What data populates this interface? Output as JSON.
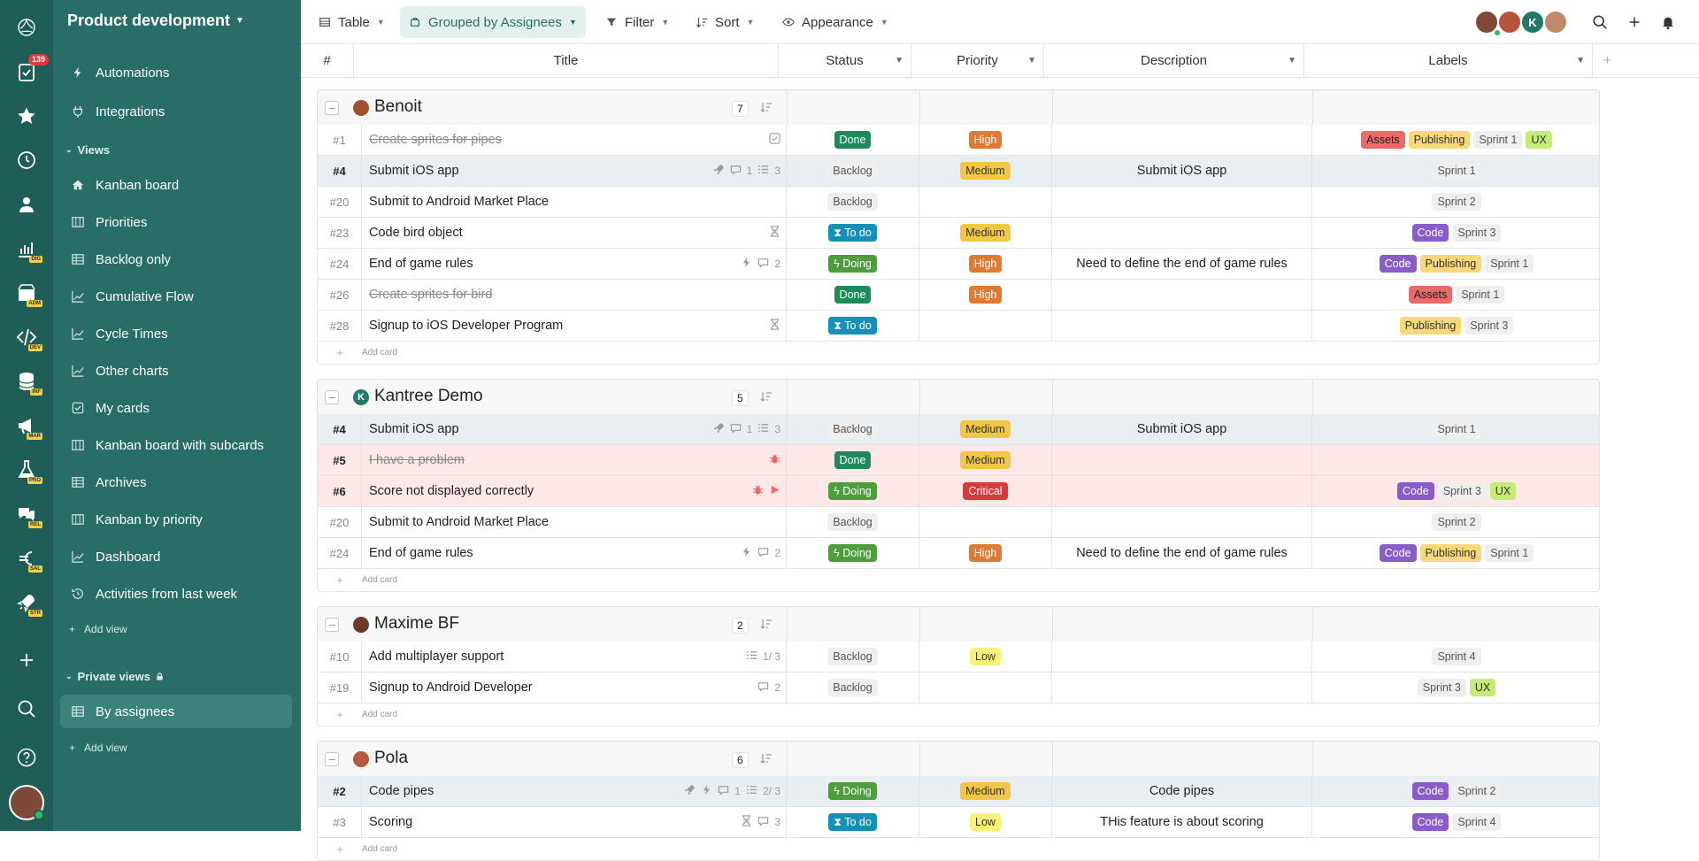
{
  "app": {
    "notifications_count": "139",
    "rail_icons": [
      "logo-icon",
      "tasks-icon",
      "star-icon",
      "clock-icon",
      "user-icon",
      "chart-icon",
      "package-icon",
      "code-icon",
      "database-icon",
      "megaphone-icon",
      "flask-icon",
      "chat-icon",
      "euro-icon",
      "rocket-icon",
      "plus-icon",
      "search-icon",
      "help-icon"
    ],
    "rail_tags": {
      "chart": "DIG",
      "package": "ADM",
      "code": "DEV",
      "database": "INF",
      "megaphone": "MAR",
      "flask": "PRO",
      "chat": "REL",
      "euro": "SAL",
      "rocket": "STR"
    }
  },
  "sidebar": {
    "workspace": "Product development",
    "top_items": [
      {
        "label": "Automations",
        "icon": "bolt-icon"
      },
      {
        "label": "Integrations",
        "icon": "plug-icon"
      }
    ],
    "views_label": "Views",
    "views": [
      {
        "label": "Kanban board",
        "icon": "home-icon"
      },
      {
        "label": "Priorities",
        "icon": "board-icon"
      },
      {
        "label": "Backlog only",
        "icon": "table-icon"
      },
      {
        "label": "Cumulative Flow",
        "icon": "chart-line-icon"
      },
      {
        "label": "Cycle Times",
        "icon": "chart-line-icon"
      },
      {
        "label": "Other charts",
        "icon": "chart-line-icon"
      },
      {
        "label": "My cards",
        "icon": "check-square-icon"
      },
      {
        "label": "Kanban board with subcards",
        "icon": "board-icon"
      },
      {
        "label": "Archives",
        "icon": "table-icon"
      },
      {
        "label": "Kanban by priority",
        "icon": "board-icon"
      },
      {
        "label": "Dashboard",
        "icon": "chart-line-icon"
      },
      {
        "label": "Activities from last week",
        "icon": "history-icon"
      }
    ],
    "add_view": "Add view",
    "private_views_label": "Private views",
    "private_views": [
      {
        "label": "By assignees",
        "icon": "table-icon"
      }
    ],
    "add_view_private": "Add view"
  },
  "toolbar": {
    "table": "Table",
    "grouped": "Grouped by Assignees",
    "filter": "Filter",
    "sort": "Sort",
    "appearance": "Appearance"
  },
  "columns": {
    "num": "#",
    "title": "Title",
    "status": "Status",
    "priority": "Priority",
    "description": "Description",
    "labels": "Labels"
  },
  "add_card": "Add card",
  "groups": [
    {
      "name": "Benoit",
      "count": "7",
      "avatar_color": "#a0522d",
      "rows": [
        {
          "num": "#1",
          "title": "Create sprites for pipes",
          "strike": true,
          "icons": [
            "checklist-icon"
          ],
          "status": "Done",
          "priority": "High",
          "desc": "",
          "labels": [
            "Assets",
            "Publishing",
            "Sprint 1",
            "UX"
          ]
        },
        {
          "num": "#4",
          "title": "Submit iOS app",
          "hi": true,
          "icons": [
            "rocket-icon",
            "comment-icon:1",
            "list-icon:3"
          ],
          "status": "Backlog",
          "priority": "Medium",
          "desc": "Submit iOS app",
          "labels": [
            "Sprint 1"
          ]
        },
        {
          "num": "#20",
          "title": "Submit to Android Market Place",
          "icons": [],
          "status": "Backlog",
          "priority": "",
          "desc": "",
          "labels": [
            "Sprint 2"
          ]
        },
        {
          "num": "#23",
          "title": "Code bird object",
          "icons": [
            "hourglass-icon"
          ],
          "status": "To do",
          "priority": "Medium",
          "desc": "",
          "labels": [
            "Code",
            "Sprint 3"
          ]
        },
        {
          "num": "#24",
          "title": "End of game rules",
          "icons": [
            "bolt-icon",
            "comment-icon:2"
          ],
          "status": "Doing",
          "priority": "High",
          "desc": "Need to define the end of game rules",
          "labels": [
            "Code",
            "Publishing",
            "Sprint 1"
          ]
        },
        {
          "num": "#26",
          "title": "Create sprites for bird",
          "strike": true,
          "icons": [],
          "status": "Done",
          "priority": "High",
          "desc": "",
          "labels": [
            "Assets",
            "Sprint 1"
          ]
        },
        {
          "num": "#28",
          "title": "Signup to iOS Developer Program",
          "icons": [
            "hourglass-icon"
          ],
          "status": "To do",
          "priority": "",
          "desc": "",
          "labels": [
            "Publishing",
            "Sprint 3"
          ]
        }
      ]
    },
    {
      "name": "Kantree Demo",
      "count": "5",
      "avatar_letter": "K",
      "avatar_color": "#1f7a6c",
      "rows": [
        {
          "num": "#4",
          "title": "Submit iOS app",
          "hi": true,
          "icons": [
            "rocket-icon",
            "comment-icon:1",
            "list-icon:3"
          ],
          "status": "Backlog",
          "priority": "Medium",
          "desc": "Submit iOS app",
          "labels": [
            "Sprint 1"
          ]
        },
        {
          "num": "#5",
          "title": "I have a problem",
          "strike": true,
          "red": true,
          "icons": [
            "bug-icon"
          ],
          "status": "Done",
          "priority": "Medium",
          "desc": "",
          "labels": []
        },
        {
          "num": "#6",
          "title": "Score not displayed correctly",
          "red": true,
          "icons": [
            "bug-icon",
            "play-icon"
          ],
          "status": "Doing",
          "priority": "Critical",
          "desc": "",
          "labels": [
            "Code",
            "Sprint 3",
            "UX"
          ]
        },
        {
          "num": "#20",
          "title": "Submit to Android Market Place",
          "icons": [],
          "status": "Backlog",
          "priority": "",
          "desc": "",
          "labels": [
            "Sprint 2"
          ]
        },
        {
          "num": "#24",
          "title": "End of game rules",
          "icons": [
            "bolt-icon",
            "comment-icon:2"
          ],
          "status": "Doing",
          "priority": "High",
          "desc": "Need to define the end of game rules",
          "labels": [
            "Code",
            "Publishing",
            "Sprint 1"
          ]
        }
      ]
    },
    {
      "name": "Maxime BF",
      "count": "2",
      "avatar_color": "#6b3a2a",
      "rows": [
        {
          "num": "#10",
          "title": "Add multiplayer support",
          "icons": [
            "list-icon:1/ 3"
          ],
          "status": "Backlog",
          "priority": "Low",
          "desc": "",
          "labels": [
            "Sprint 4"
          ]
        },
        {
          "num": "#19",
          "title": "Signup to Android Developer",
          "icons": [
            "comment-icon:2"
          ],
          "status": "Backlog",
          "priority": "",
          "desc": "",
          "labels": [
            "Sprint 3",
            "UX"
          ]
        }
      ]
    },
    {
      "name": "Pola",
      "count": "6",
      "avatar_color": "#b55a3c",
      "rows": [
        {
          "num": "#2",
          "title": "Code pipes",
          "hi": true,
          "icons": [
            "rocket-icon",
            "bolt-icon",
            "comment-icon:1",
            "list-icon:2/ 3"
          ],
          "status": "Doing",
          "priority": "Medium",
          "desc": "Code pipes",
          "labels": [
            "Code",
            "Sprint 2"
          ]
        },
        {
          "num": "#3",
          "title": "Scoring",
          "icons": [
            "hourglass-icon",
            "comment-icon:3"
          ],
          "status": "To do",
          "priority": "Low",
          "desc": "THis feature is about scoring",
          "labels": [
            "Code",
            "Sprint 4"
          ]
        }
      ]
    }
  ]
}
